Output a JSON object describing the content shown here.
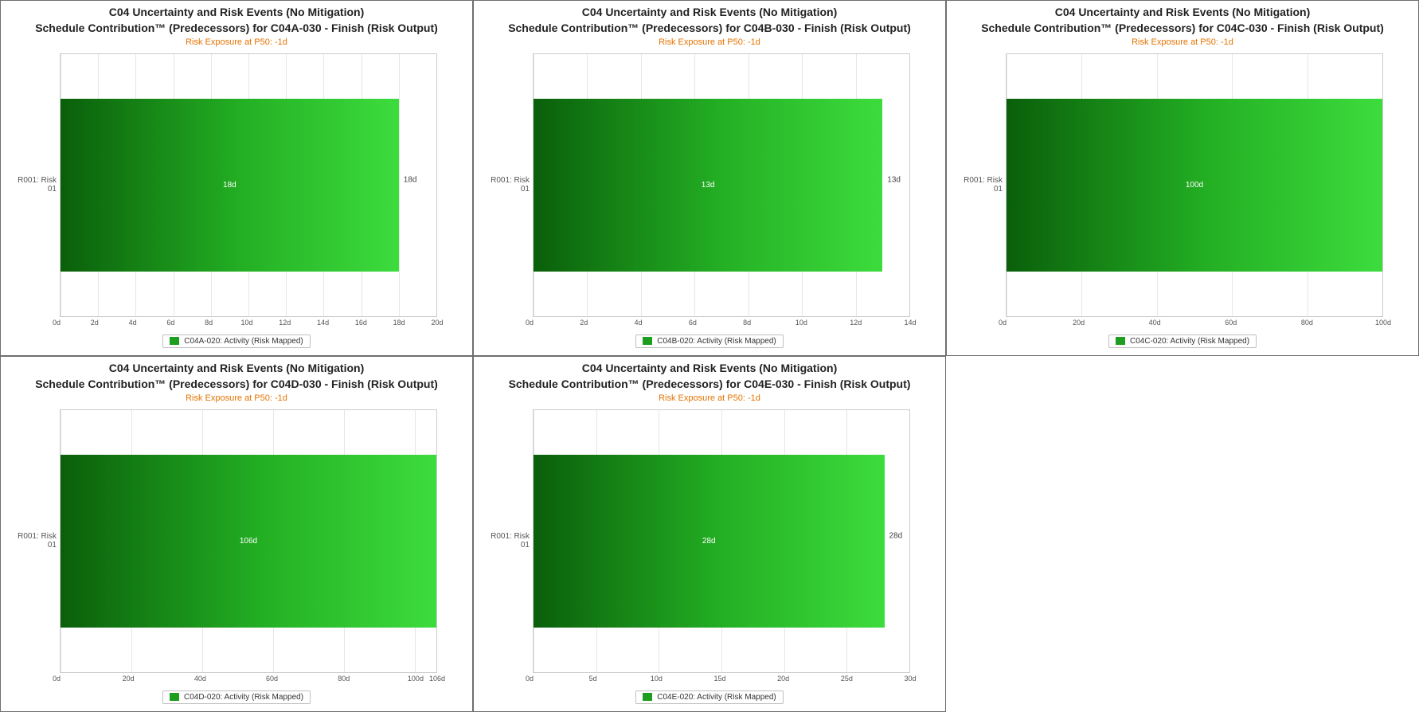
{
  "chart_data": [
    {
      "id": "A",
      "title": "C04 Uncertainty and Risk Events (No Mitigation)",
      "subtitle": "Schedule Contribution™ (Predecessors) for C04A-030 - Finish (Risk Output)",
      "exposure": "Risk Exposure at P50: -1d",
      "type": "bar",
      "orientation": "horizontal",
      "categories": [
        "R001: Risk 01"
      ],
      "series": [
        {
          "name": "C04A-020: Activity (Risk Mapped)",
          "values": [
            18
          ]
        }
      ],
      "value_suffix": "d",
      "xlim": [
        0,
        20
      ],
      "xticks": [
        0,
        2,
        4,
        6,
        8,
        10,
        12,
        14,
        16,
        18,
        20
      ],
      "legend": "C04A-020: Activity (Risk Mapped)"
    },
    {
      "id": "B",
      "title": "C04 Uncertainty and Risk Events (No Mitigation)",
      "subtitle": "Schedule Contribution™ (Predecessors) for C04B-030 - Finish (Risk Output)",
      "exposure": "Risk Exposure at P50: -1d",
      "type": "bar",
      "orientation": "horizontal",
      "categories": [
        "R001: Risk 01"
      ],
      "series": [
        {
          "name": "C04B-020: Activity (Risk Mapped)",
          "values": [
            13
          ]
        }
      ],
      "value_suffix": "d",
      "xlim": [
        0,
        14
      ],
      "xticks": [
        0,
        2,
        4,
        6,
        8,
        10,
        12,
        14
      ],
      "legend": "C04B-020: Activity (Risk Mapped)"
    },
    {
      "id": "C",
      "title": "C04 Uncertainty and Risk Events (No Mitigation)",
      "subtitle": "Schedule Contribution™ (Predecessors) for C04C-030 - Finish (Risk Output)",
      "exposure": "Risk Exposure at P50: -1d",
      "type": "bar",
      "orientation": "horizontal",
      "categories": [
        "R001: Risk 01"
      ],
      "series": [
        {
          "name": "C04C-020: Activity (Risk Mapped)",
          "values": [
            100
          ]
        }
      ],
      "value_suffix": "d",
      "xlim": [
        0,
        100
      ],
      "xticks": [
        0,
        20,
        40,
        60,
        80,
        100
      ],
      "legend": "C04C-020: Activity (Risk Mapped)"
    },
    {
      "id": "D",
      "title": "C04 Uncertainty and Risk Events (No Mitigation)",
      "subtitle": "Schedule Contribution™ (Predecessors) for C04D-030 - Finish (Risk Output)",
      "exposure": "Risk Exposure at P50: -1d",
      "type": "bar",
      "orientation": "horizontal",
      "categories": [
        "R001: Risk 01"
      ],
      "series": [
        {
          "name": "C04D-020: Activity (Risk Mapped)",
          "values": [
            106
          ]
        }
      ],
      "value_suffix": "d",
      "xlim": [
        0,
        106
      ],
      "xticks": [
        0,
        20,
        40,
        60,
        80,
        100,
        106
      ],
      "legend": "C04D-020: Activity (Risk Mapped)"
    },
    {
      "id": "E",
      "title": "C04 Uncertainty and Risk Events (No Mitigation)",
      "subtitle": "Schedule Contribution™ (Predecessors) for C04E-030 - Finish (Risk Output)",
      "exposure": "Risk Exposure at P50: -1d",
      "type": "bar",
      "orientation": "horizontal",
      "categories": [
        "R001: Risk 01"
      ],
      "series": [
        {
          "name": "C04E-020: Activity (Risk Mapped)",
          "values": [
            28
          ]
        }
      ],
      "value_suffix": "d",
      "xlim": [
        0,
        30
      ],
      "xticks": [
        0,
        5,
        10,
        15,
        20,
        25,
        30
      ],
      "legend": "C04E-020: Activity (Risk Mapped)"
    }
  ]
}
